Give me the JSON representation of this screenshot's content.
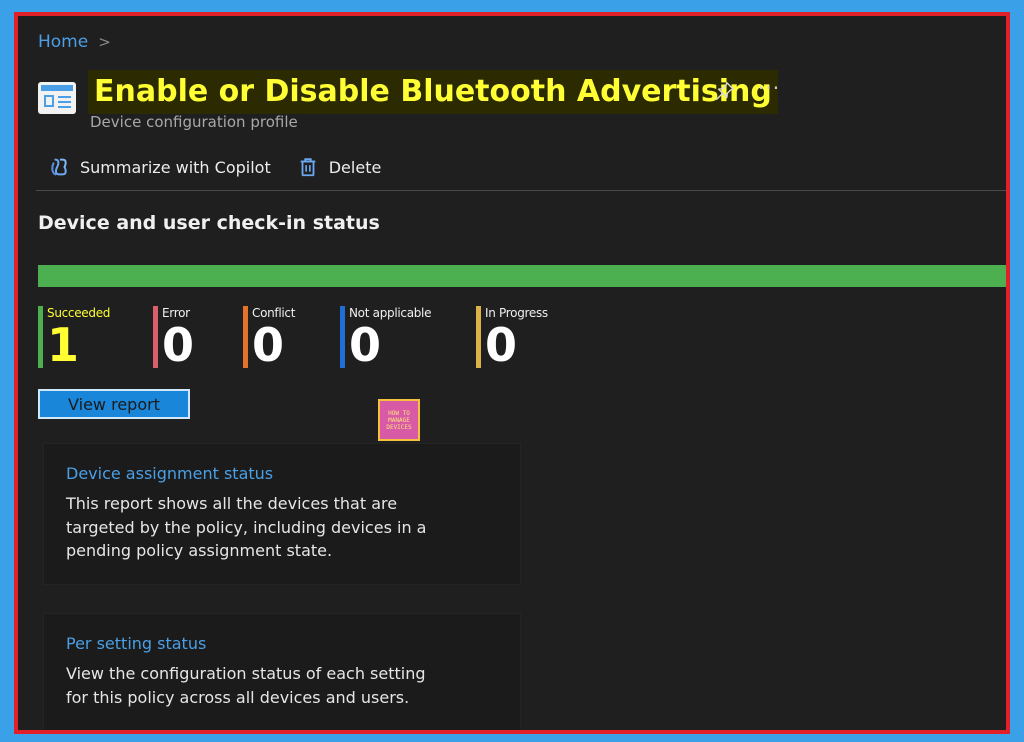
{
  "breadcrumb": {
    "home": "Home",
    "separator": ">"
  },
  "header": {
    "title": "Enable or Disable Bluetooth Advertising",
    "subtitle": "Device configuration profile",
    "more": "···"
  },
  "toolbar": {
    "copilot_label": "Summarize with Copilot",
    "delete_label": "Delete"
  },
  "checkin": {
    "title": "Device and user check-in status",
    "progress_fraction": 1.0,
    "progress_color": "#4caf50",
    "stats": [
      {
        "label": "Succeeded",
        "value": "1",
        "color": "#4caf50",
        "label_color": "#ffff33",
        "value_color": "#ffff33"
      },
      {
        "label": "Error",
        "value": "0",
        "color": "#d9606a"
      },
      {
        "label": "Conflict",
        "value": "0",
        "color": "#e3732b"
      },
      {
        "label": "Not applicable",
        "value": "0",
        "color": "#1f6fd6"
      },
      {
        "label": "In Progress",
        "value": "0",
        "color": "#d9b24a"
      }
    ],
    "view_report_label": "View report"
  },
  "logo": {
    "line1": "HOW TO",
    "line2": "MANAGE",
    "line3": "DEVICES"
  },
  "cards": [
    {
      "title": "Device assignment status",
      "description": "This report shows all the devices that are targeted by the policy, including devices in a pending policy assignment state."
    },
    {
      "title": "Per setting status",
      "description": "View the configuration status of each setting for this policy across all devices and users."
    }
  ],
  "colors": {
    "accent": "#4a9fe6",
    "frame_border": "#e2202a",
    "highlight": "#ffff33"
  }
}
